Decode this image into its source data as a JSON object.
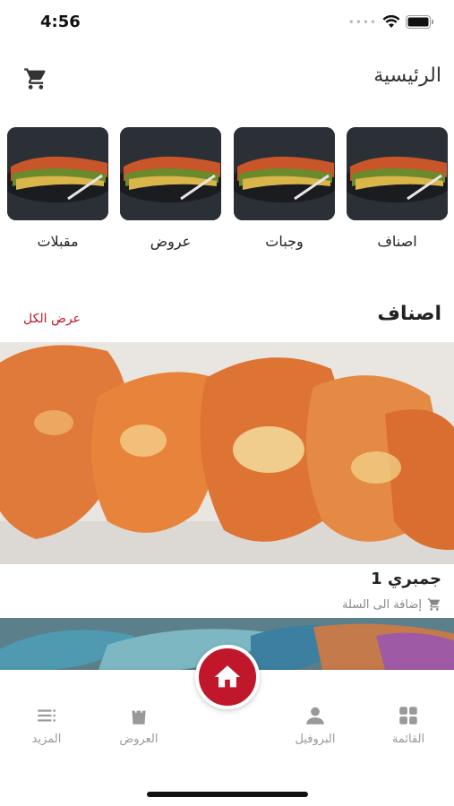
{
  "status_bar": {
    "time": "4:56"
  },
  "header": {
    "title": "الرئيسية",
    "cart_icon": "cart-icon"
  },
  "categories": [
    {
      "label": "اصناف"
    },
    {
      "label": "وجبات"
    },
    {
      "label": "عروض"
    },
    {
      "label": "مقبلات"
    }
  ],
  "section": {
    "title": "اصناف",
    "view_all": "عرض الكل"
  },
  "product": {
    "name": "جمبري 1",
    "add_to_cart": "إضافة الى السلة"
  },
  "bottom_nav": {
    "items": [
      {
        "label": "القائمة",
        "icon": "grid-icon"
      },
      {
        "label": "البروفيل",
        "icon": "profile-icon"
      },
      {
        "label": "العروض",
        "icon": "shopping-bag-icon"
      },
      {
        "label": "المزيد",
        "icon": "menu-icon"
      }
    ],
    "home_icon": "home-icon"
  },
  "colors": {
    "accent": "#c0172a",
    "muted": "#999999"
  }
}
